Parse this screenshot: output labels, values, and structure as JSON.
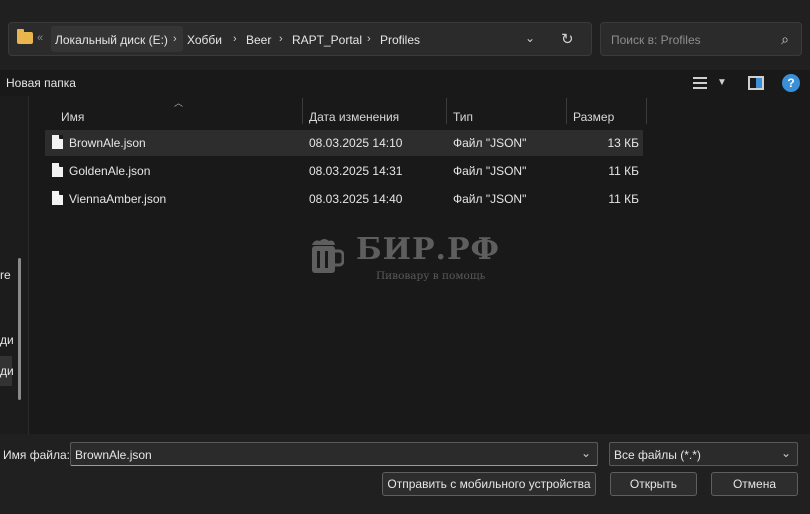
{
  "address_bar": {
    "overflow": "«",
    "crumbs": [
      "Локальный диск (E:)",
      "Хобби",
      "Beer",
      "RAPT_Portal",
      "Profiles"
    ]
  },
  "search": {
    "placeholder": "Поиск в: Profiles"
  },
  "toolbar": {
    "new_folder": "Новая папка",
    "help": "?"
  },
  "nav_fragments": [
    "re",
    "ди",
    "ди"
  ],
  "columns": {
    "name": "Имя",
    "date": "Дата изменения",
    "type": "Тип",
    "size": "Размер"
  },
  "files": [
    {
      "name": "BrownAle.json",
      "date": "08.03.2025 14:10",
      "type": "Файл \"JSON\"",
      "size": "13 КБ",
      "selected": true
    },
    {
      "name": "GoldenAle.json",
      "date": "08.03.2025 14:31",
      "type": "Файл \"JSON\"",
      "size": "11 КБ",
      "selected": false
    },
    {
      "name": "ViennaAmber.json",
      "date": "08.03.2025 14:40",
      "type": "Файл \"JSON\"",
      "size": "11 КБ",
      "selected": false
    }
  ],
  "watermark": {
    "title": "БИР.РФ",
    "subtitle": "Пивовару в помощь"
  },
  "footer": {
    "filename_label": "Имя файла:",
    "filename_value": "BrownAle.json",
    "filetype": "Все файлы (*.*)",
    "send_mobile": "Отправить с мобильного устройства",
    "open": "Открыть",
    "cancel": "Отмена"
  },
  "colors": {
    "accent": "#3a8fd9",
    "folder": "#e8b64c",
    "background": "#191919"
  }
}
